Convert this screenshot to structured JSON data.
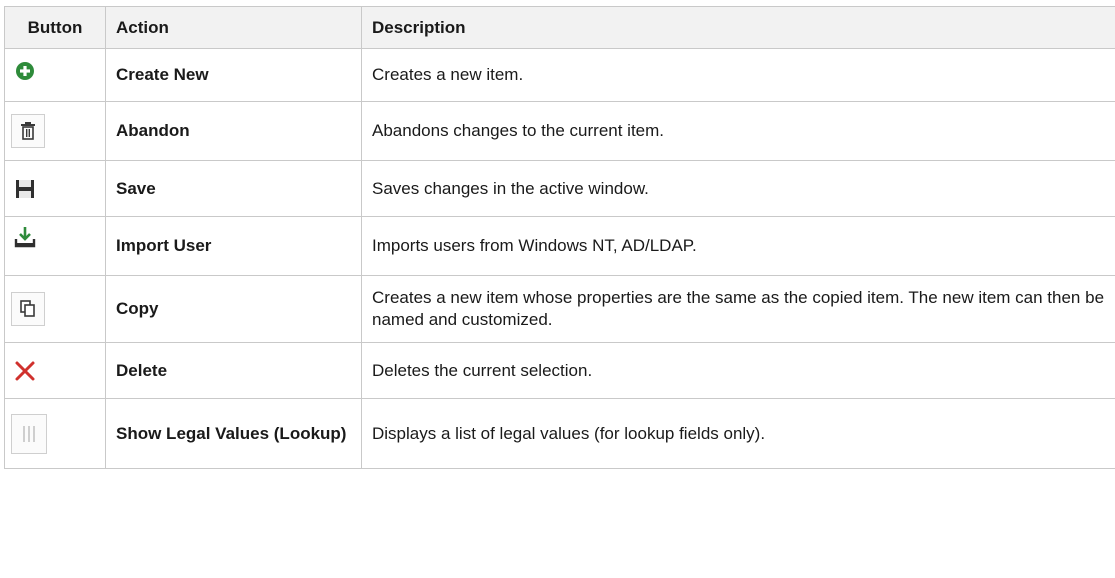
{
  "table": {
    "headers": [
      "Button",
      "Action",
      "Description"
    ],
    "rows": [
      {
        "icon": "create-new-icon",
        "action": "Create New",
        "description": "Creates a new item."
      },
      {
        "icon": "trash-icon",
        "action": "Abandon",
        "description": "Abandons changes to the current item."
      },
      {
        "icon": "save-icon",
        "action": "Save",
        "description": "Saves changes in the active window."
      },
      {
        "icon": "import-icon",
        "action": "Import User",
        "description": "Imports users from Windows NT, AD/LDAP."
      },
      {
        "icon": "copy-icon",
        "action": "Copy",
        "description": "Creates a new item whose properties are the same as the copied item. The new item can then be named and customized."
      },
      {
        "icon": "delete-icon",
        "action": "Delete",
        "description": "Deletes the current selection."
      },
      {
        "icon": "lookup-icon",
        "action": "Show Legal Values (Lookup)",
        "description": "Displays a list of legal values (for lookup fields only)."
      }
    ]
  },
  "colors": {
    "create_green": "#2e8b3a",
    "delete_red": "#d0312d",
    "icon_dark": "#3a3a3a",
    "header_bg": "#f2f2f2",
    "border": "#c9c9c9"
  }
}
